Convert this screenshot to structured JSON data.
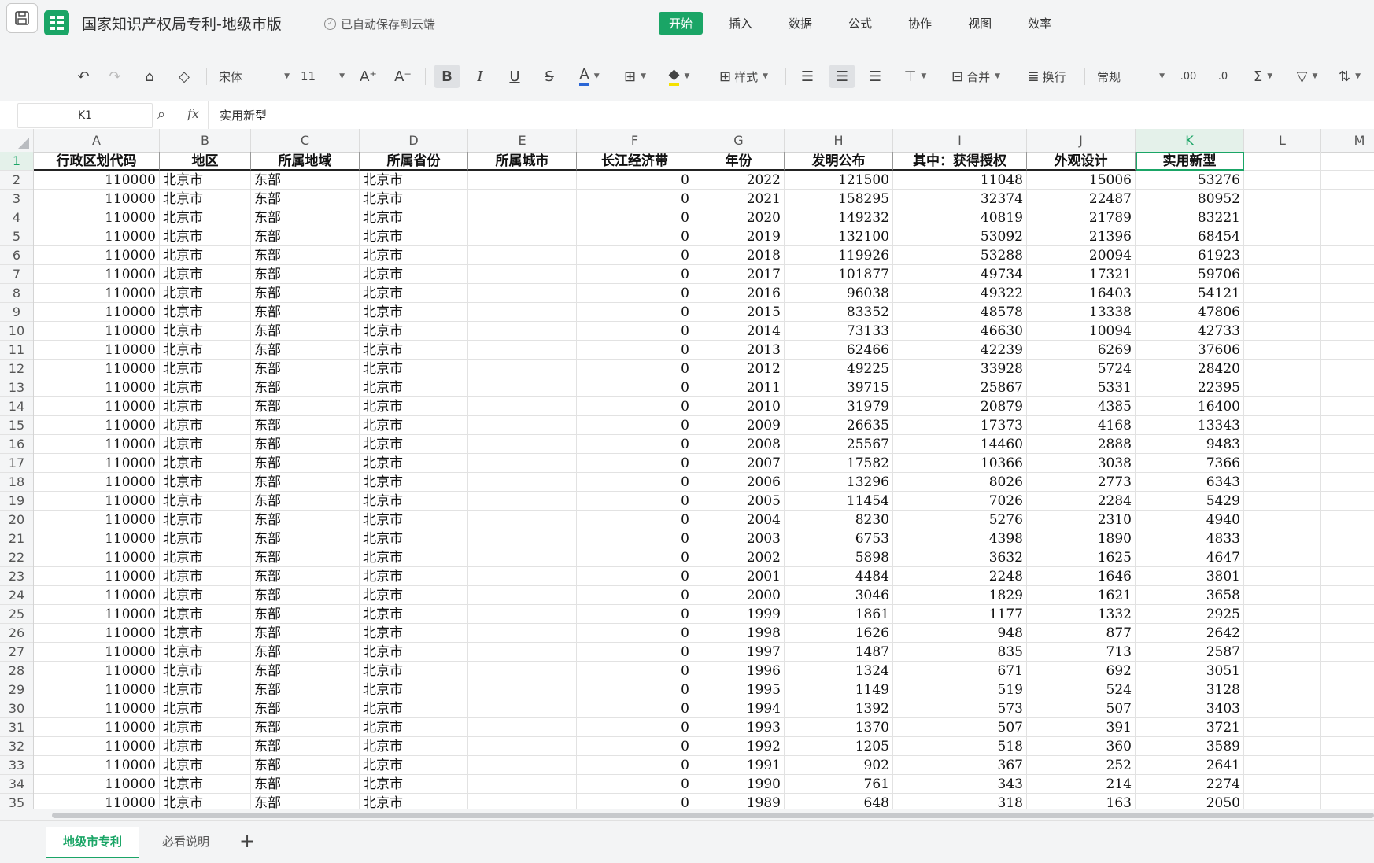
{
  "titlebar": {
    "doc_title": "国家知识产权局专利-地级市版",
    "save_status": "已自动保存到云端",
    "menus": [
      "开始",
      "插入",
      "数据",
      "公式",
      "协作",
      "视图",
      "效率"
    ],
    "active_menu": "开始"
  },
  "toolbar": {
    "font_name": "宋体",
    "font_size": "11",
    "bold": "B",
    "italic": "I",
    "underline": "U",
    "strike": "S",
    "font_color": "A",
    "styles_label": "样式",
    "merge_label": "合并",
    "wrap_label": "换行",
    "number_format": "常规",
    "accent_color": "#1aa566",
    "highlight_color": "#f5e100",
    "font_color_bar": "#2a66d6"
  },
  "formula": {
    "cell_ref": "K1",
    "fx": "fx",
    "content": "实用新型"
  },
  "columns": [
    "A",
    "B",
    "C",
    "D",
    "E",
    "F",
    "G",
    "H",
    "I",
    "J",
    "K",
    "L",
    "M"
  ],
  "header_row": [
    "行政区划代码",
    "地区",
    "所属地域",
    "所属省份",
    "所属城市",
    "长江经济带",
    "年份",
    "发明公布",
    "其中：获得授权",
    "外观设计",
    "实用新型"
  ],
  "const": {
    "code": "110000",
    "region": "北京市",
    "area": "东部",
    "province": "北京市",
    "city": "",
    "yangtze": "0"
  },
  "rows": [
    [
      "2022",
      "121500",
      "11048",
      "15006",
      "53276"
    ],
    [
      "2021",
      "158295",
      "32374",
      "22487",
      "80952"
    ],
    [
      "2020",
      "149232",
      "40819",
      "21789",
      "83221"
    ],
    [
      "2019",
      "132100",
      "53092",
      "21396",
      "68454"
    ],
    [
      "2018",
      "119926",
      "53288",
      "20094",
      "61923"
    ],
    [
      "2017",
      "101877",
      "49734",
      "17321",
      "59706"
    ],
    [
      "2016",
      "96038",
      "49322",
      "16403",
      "54121"
    ],
    [
      "2015",
      "83352",
      "48578",
      "13338",
      "47806"
    ],
    [
      "2014",
      "73133",
      "46630",
      "10094",
      "42733"
    ],
    [
      "2013",
      "62466",
      "42239",
      "6269",
      "37606"
    ],
    [
      "2012",
      "49225",
      "33928",
      "5724",
      "28420"
    ],
    [
      "2011",
      "39715",
      "25867",
      "5331",
      "22395"
    ],
    [
      "2010",
      "31979",
      "20879",
      "4385",
      "16400"
    ],
    [
      "2009",
      "26635",
      "17373",
      "4168",
      "13343"
    ],
    [
      "2008",
      "25567",
      "14460",
      "2888",
      "9483"
    ],
    [
      "2007",
      "17582",
      "10366",
      "3038",
      "7366"
    ],
    [
      "2006",
      "13296",
      "8026",
      "2773",
      "6343"
    ],
    [
      "2005",
      "11454",
      "7026",
      "2284",
      "5429"
    ],
    [
      "2004",
      "8230",
      "5276",
      "2310",
      "4940"
    ],
    [
      "2003",
      "6753",
      "4398",
      "1890",
      "4833"
    ],
    [
      "2002",
      "5898",
      "3632",
      "1625",
      "4647"
    ],
    [
      "2001",
      "4484",
      "2248",
      "1646",
      "3801"
    ],
    [
      "2000",
      "3046",
      "1829",
      "1621",
      "3658"
    ],
    [
      "1999",
      "1861",
      "1177",
      "1332",
      "2925"
    ],
    [
      "1998",
      "1626",
      "948",
      "877",
      "2642"
    ],
    [
      "1997",
      "1487",
      "835",
      "713",
      "2587"
    ],
    [
      "1996",
      "1324",
      "671",
      "692",
      "3051"
    ],
    [
      "1995",
      "1149",
      "519",
      "524",
      "3128"
    ],
    [
      "1994",
      "1392",
      "573",
      "507",
      "3403"
    ],
    [
      "1993",
      "1370",
      "507",
      "391",
      "3721"
    ],
    [
      "1992",
      "1205",
      "518",
      "360",
      "3589"
    ],
    [
      "1991",
      "902",
      "367",
      "252",
      "2641"
    ],
    [
      "1990",
      "761",
      "343",
      "214",
      "2274"
    ],
    [
      "1989",
      "648",
      "318",
      "163",
      "2050"
    ]
  ],
  "sheets": [
    "地级市专利",
    "必看说明"
  ],
  "active_sheet": "地级市专利"
}
